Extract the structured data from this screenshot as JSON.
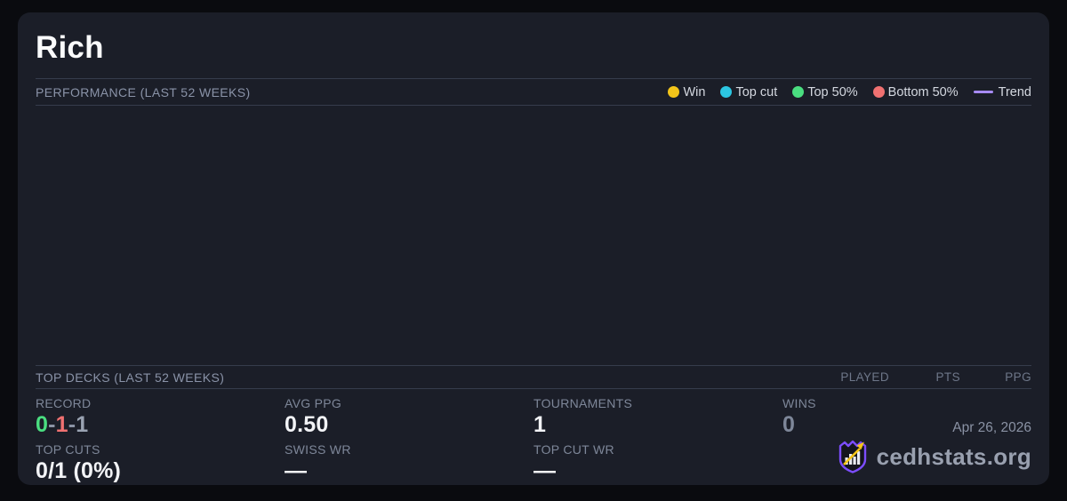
{
  "player": {
    "name": "Rich"
  },
  "performance": {
    "title": "PERFORMANCE (LAST 52 WEEKS)",
    "legend": [
      {
        "label": "Win",
        "color": "#f3c51a"
      },
      {
        "label": "Top cut",
        "color": "#2cc6e2"
      },
      {
        "label": "Top 50%",
        "color": "#4ade80"
      },
      {
        "label": "Bottom 50%",
        "color": "#f07171"
      },
      {
        "label": "Trend",
        "color": "#a78bfa"
      }
    ],
    "chart_data": {
      "type": "scatter",
      "points": []
    }
  },
  "top_decks": {
    "title": "TOP DECKS (LAST 52 WEEKS)",
    "columns": [
      "PLAYED",
      "PTS",
      "PPG"
    ]
  },
  "stats": {
    "record": {
      "label": "RECORD",
      "parts": [
        {
          "text": "0",
          "color": "#4ade80"
        },
        {
          "text": "-",
          "color": "#8b93a5"
        },
        {
          "text": "1",
          "color": "#f07171"
        },
        {
          "text": "-",
          "color": "#8b93a5"
        },
        {
          "text": "1",
          "color": "#9aa3b2"
        }
      ]
    },
    "avg_ppg": {
      "label": "AVG PPG",
      "value": "0.50"
    },
    "tournaments": {
      "label": "TOURNAMENTS",
      "value": "1"
    },
    "wins": {
      "label": "WINS",
      "value": "0"
    },
    "top_cuts": {
      "label": "TOP CUTS",
      "value": "0/1 (0%)"
    },
    "swiss_wr": {
      "label": "SWISS WR",
      "value": "—"
    },
    "top_cut_wr": {
      "label": "TOP CUT WR",
      "value": "—"
    }
  },
  "colors": {
    "muted_value": "#7e8799",
    "brand_purple": "#7c4dff",
    "brand_gold": "#f5c518"
  },
  "footer": {
    "date": "Apr 26, 2026",
    "brand": "cedhstats.org"
  }
}
